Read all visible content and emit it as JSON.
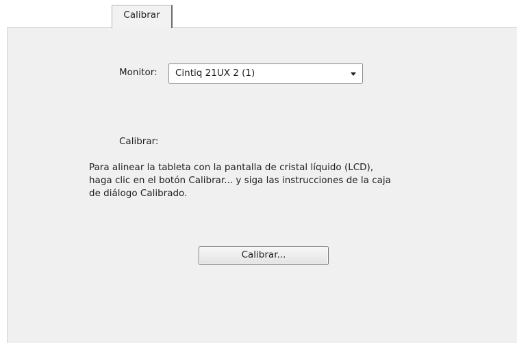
{
  "tabs": [
    {
      "label": "Calibrar",
      "active": true
    }
  ],
  "monitor": {
    "label": "Monitor:",
    "selected": "Cintiq 21UX 2 (1)"
  },
  "calibrate": {
    "label": "Calibrar:",
    "description_lines": [
      "Para alinear la tableta con la pantalla de cristal líquido (LCD),",
      "haga clic en el botón Calibrar... y siga las instrucciones de la caja",
      "de diálogo Calibrado."
    ],
    "button_label": "Calibrar..."
  },
  "colors": {
    "panel_bg": "#f0f0f0",
    "page_bg": "#ffffff",
    "text": "#1e1e1e"
  }
}
